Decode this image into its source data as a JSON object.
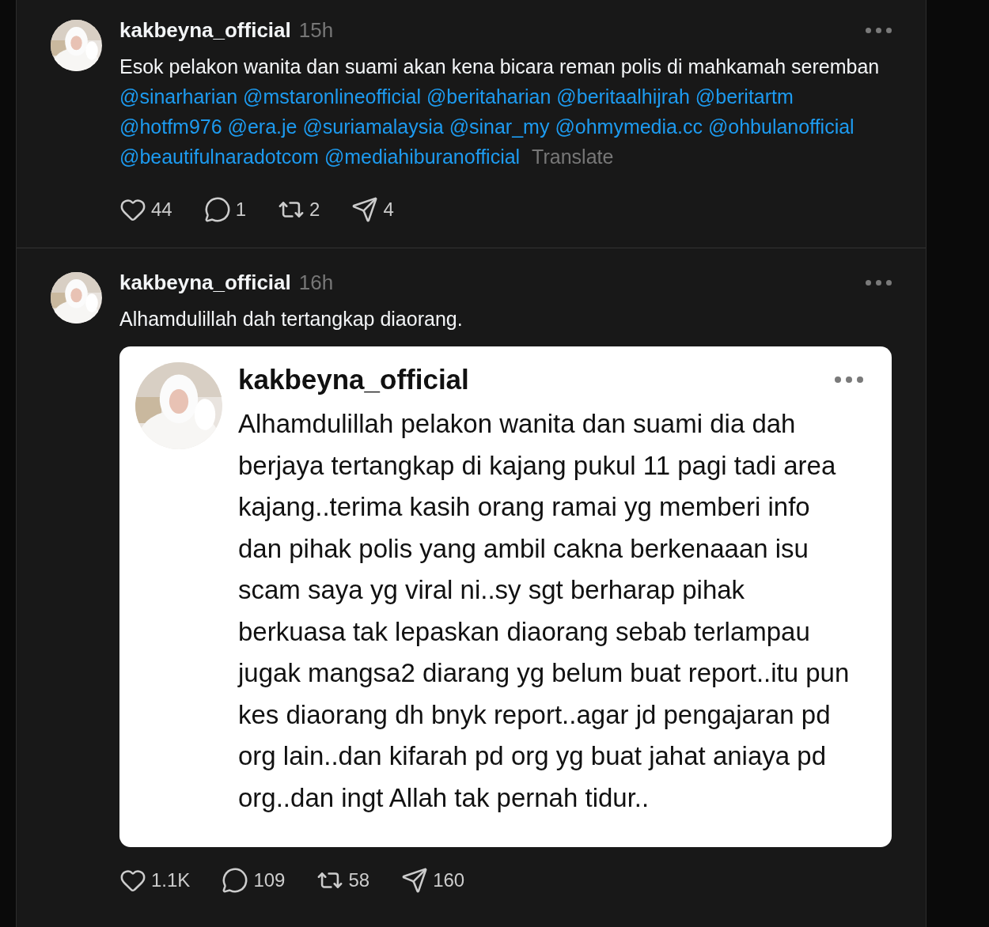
{
  "posts": [
    {
      "author": "kakbeyna_official",
      "time": "15h",
      "body": [
        {
          "kind": "text",
          "text": "Esok pelakon wanita dan suami akan kena bicara reman polis di mahkamah seremban"
        },
        {
          "kind": "mention",
          "text": "@sinarharian"
        },
        {
          "kind": "mention",
          "text": "@mstaronlineofficial"
        },
        {
          "kind": "mention",
          "text": "@beritaharian"
        },
        {
          "kind": "mention",
          "text": "@beritaalhijrah"
        },
        {
          "kind": "mention",
          "text": "@beritartm"
        },
        {
          "kind": "mention",
          "text": "@hotfm976"
        },
        {
          "kind": "mention",
          "text": "@era.je"
        },
        {
          "kind": "mention",
          "text": "@suriamalaysia"
        },
        {
          "kind": "mention",
          "text": "@sinar_my"
        },
        {
          "kind": "mention",
          "text": "@ohmymedia.cc"
        },
        {
          "kind": "mention",
          "text": "@ohbulanofficial"
        },
        {
          "kind": "mention",
          "text": "@beautifulnaradotcom"
        },
        {
          "kind": "mention",
          "text": "@mediahiburanofficial"
        }
      ],
      "translate": "Translate",
      "actions": [
        {
          "kind": "like",
          "count": "44"
        },
        {
          "kind": "reply",
          "count": "1"
        },
        {
          "kind": "repost",
          "count": "2"
        },
        {
          "kind": "share",
          "count": "4"
        }
      ]
    },
    {
      "author": "kakbeyna_official",
      "time": "16h",
      "body": [
        {
          "kind": "text",
          "text": "Alhamdulillah dah tertangkap diaorang."
        }
      ],
      "attachment": {
        "author": "kakbeyna_official",
        "text": "Alhamdulillah pelakon wanita dan suami dia dah berjaya tertangkap di kajang pukul 11 pagi tadi area kajang..terima kasih orang ramai yg memberi info dan pihak polis yang ambil cakna berkenaaan isu scam saya yg viral ni..sy sgt berharap pihak berkuasa tak lepaskan diaorang sebab terlampau jugak mangsa2 diarang yg belum buat report..itu pun kes diaorang dh bnyk report..agar jd pengajaran pd org lain..dan kifarah pd org yg buat jahat aniaya pd org..dan ingt Allah tak pernah tidur.."
      },
      "actions": [
        {
          "kind": "like",
          "count": "1.1K"
        },
        {
          "kind": "reply",
          "count": "109"
        },
        {
          "kind": "repost",
          "count": "58"
        },
        {
          "kind": "share",
          "count": "160"
        }
      ]
    }
  ]
}
